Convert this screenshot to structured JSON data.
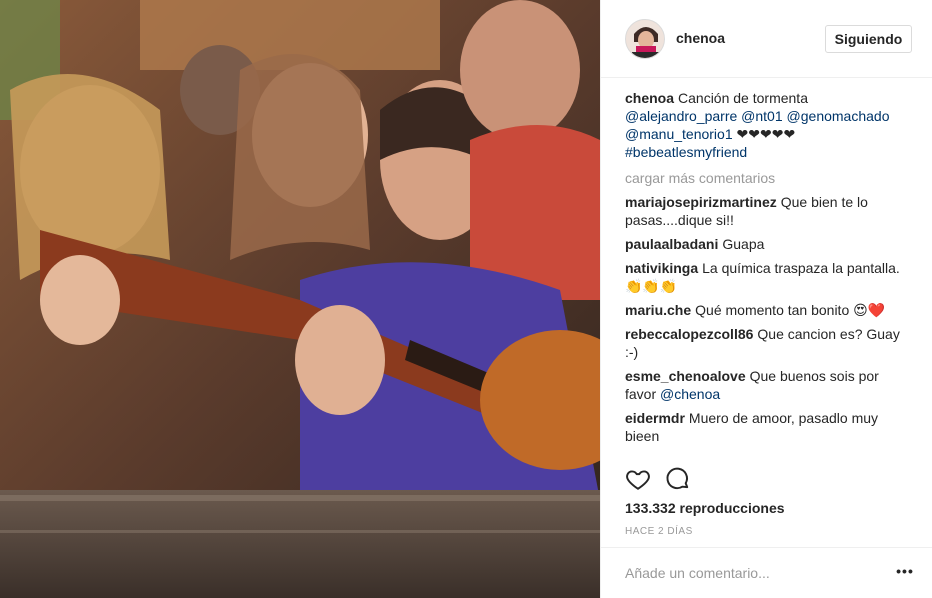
{
  "post": {
    "author": "chenoa",
    "follow_label": "Siguiendo",
    "caption": {
      "username": "chenoa",
      "text": "Canción de tormenta",
      "mentions": [
        "@alejandro_parre",
        "@nt01",
        "@genomachado",
        "@manu_tenorio1"
      ],
      "hearts": "❤❤❤❤❤",
      "hashtag": "#bebeatlesmyfriend"
    },
    "load_more": "cargar más comentarios",
    "comments": [
      {
        "user": "mariajosepirizmartinez",
        "text": "Que bien te lo pasas....dique si!!"
      },
      {
        "user": "paulaalbadani",
        "text": "Guapa"
      },
      {
        "user": "nativikinga",
        "text": "La química traspaza la pantalla. 👏👏👏"
      },
      {
        "user": "mariu.che",
        "text": "Qué momento tan bonito 😍❤️"
      },
      {
        "user": "rebeccalopezcoll86",
        "text": "Que cancion es? Guay :-)"
      },
      {
        "user": "esme_chenoalove",
        "text": "Que buenos sois por favor",
        "mention": "@chenoa"
      },
      {
        "user": "eidermdr",
        "text": "Muero de amoor, pasadlo muy bieen"
      }
    ],
    "views": "133.332 reproducciones",
    "time": "HACE 2 DÍAS",
    "comment_placeholder": "Añade un comentario...",
    "more_label": "•••"
  },
  "icons": {
    "like": "heart-icon",
    "comment": "comment-icon",
    "more": "more-options-icon"
  }
}
